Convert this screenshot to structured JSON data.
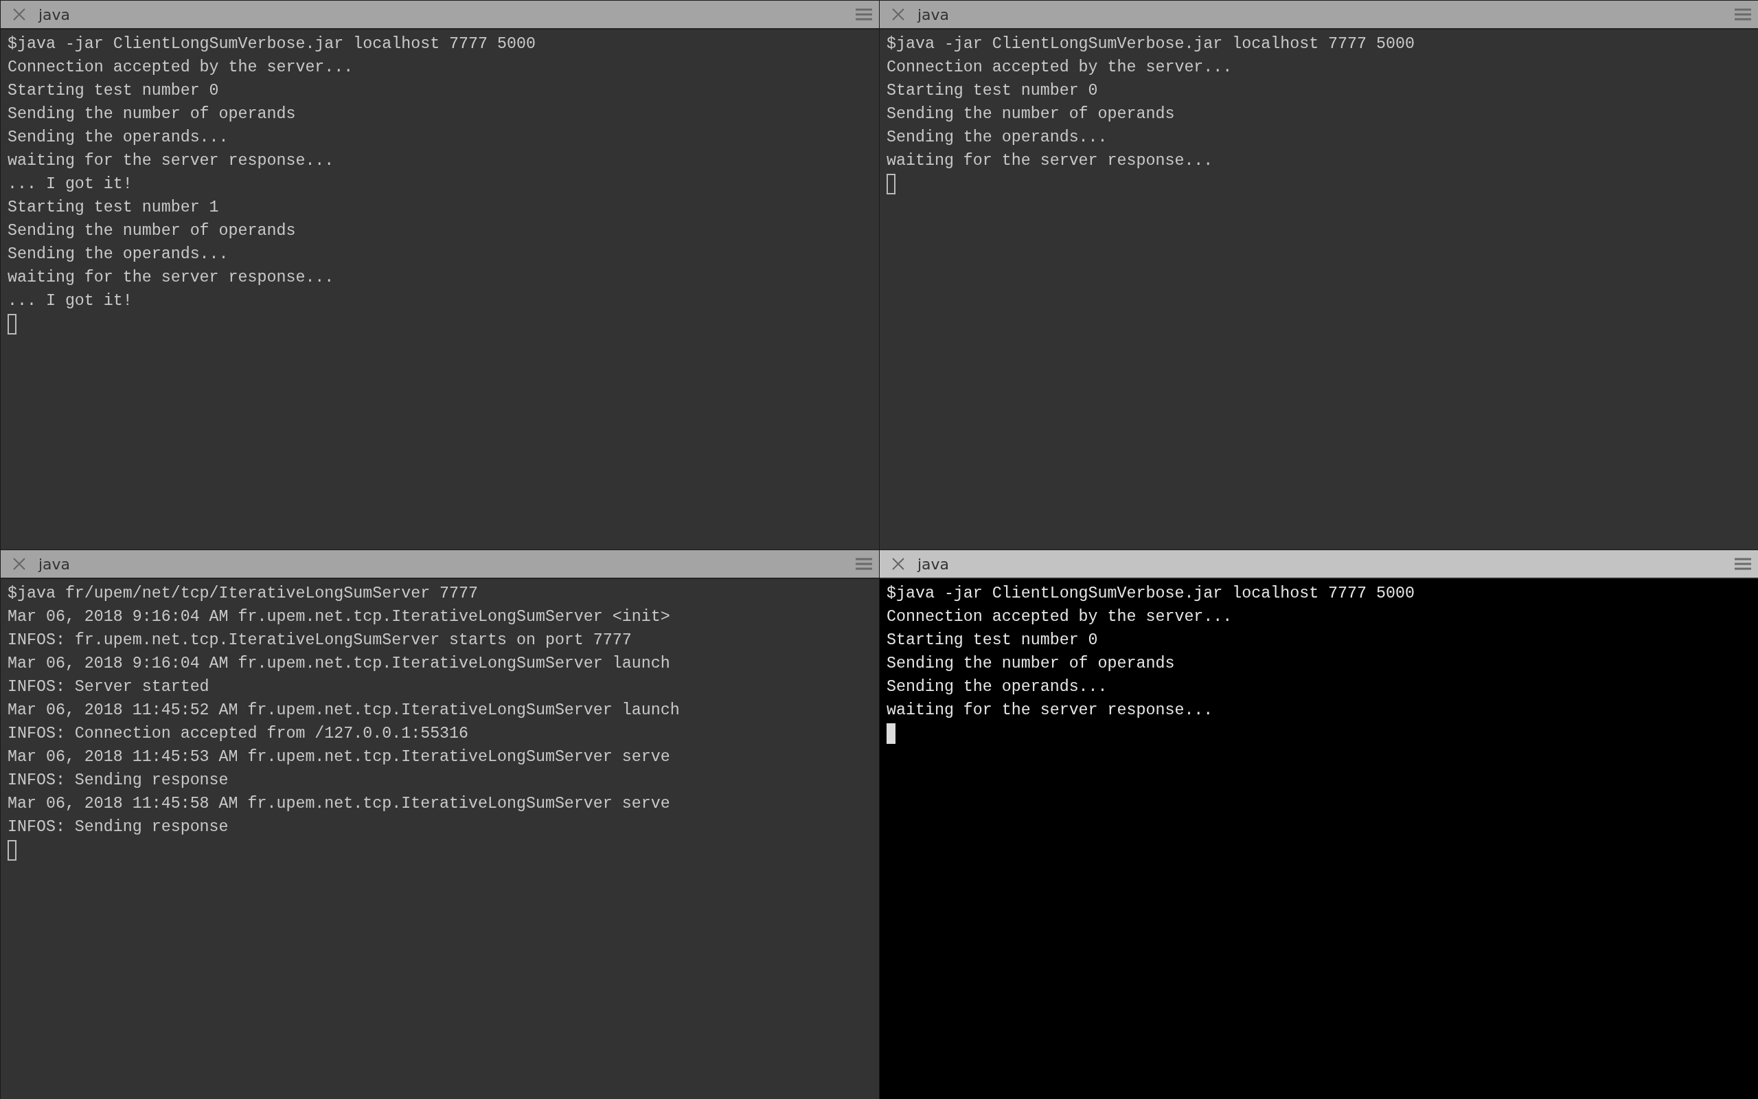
{
  "panes": [
    {
      "title": "java",
      "selected": false,
      "lines": [
        "$java -jar ClientLongSumVerbose.jar localhost 7777 5000",
        "Connection accepted by the server...",
        "Starting test number 0",
        "Sending the number of operands",
        "Sending the operands...",
        "waiting for the server response...",
        "... I got it!",
        "Starting test number 1",
        "Sending the number of operands",
        "Sending the operands...",
        "waiting for the server response...",
        "... I got it!"
      ]
    },
    {
      "title": "java",
      "selected": false,
      "lines": [
        "$java -jar ClientLongSumVerbose.jar localhost 7777 5000",
        "Connection accepted by the server...",
        "Starting test number 0",
        "Sending the number of operands",
        "Sending the operands...",
        "waiting for the server response..."
      ]
    },
    {
      "title": "java",
      "selected": false,
      "lines": [
        "$java fr/upem/net/tcp/IterativeLongSumServer 7777",
        "Mar 06, 2018 9:16:04 AM fr.upem.net.tcp.IterativeLongSumServer <init>",
        "INFOS: fr.upem.net.tcp.IterativeLongSumServer starts on port 7777",
        "Mar 06, 2018 9:16:04 AM fr.upem.net.tcp.IterativeLongSumServer launch",
        "INFOS: Server started",
        "Mar 06, 2018 11:45:52 AM fr.upem.net.tcp.IterativeLongSumServer launch",
        "INFOS: Connection accepted from /127.0.0.1:55316",
        "Mar 06, 2018 11:45:53 AM fr.upem.net.tcp.IterativeLongSumServer serve",
        "INFOS: Sending response",
        "Mar 06, 2018 11:45:58 AM fr.upem.net.tcp.IterativeLongSumServer serve",
        "INFOS: Sending response"
      ]
    },
    {
      "title": "java",
      "selected": true,
      "lines": [
        "$java -jar ClientLongSumVerbose.jar localhost 7777 5000",
        "Connection accepted by the server...",
        "Starting test number 0",
        "Sending the number of operands",
        "Sending the operands...",
        "waiting for the server response..."
      ]
    }
  ]
}
